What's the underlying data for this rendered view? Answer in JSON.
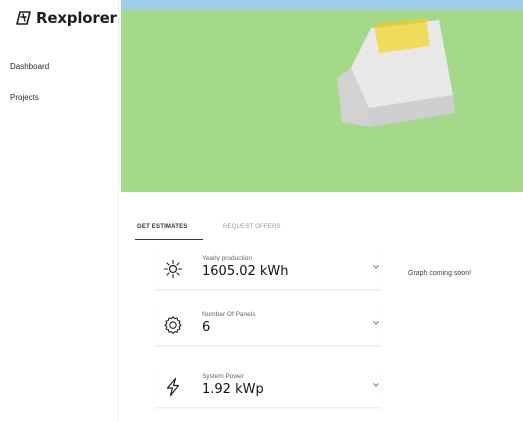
{
  "brand": {
    "name": "Rexplorer"
  },
  "sidebar": {
    "items": [
      {
        "label": "Dashboard"
      },
      {
        "label": "Projects"
      }
    ]
  },
  "tabs": [
    {
      "label": "GET ESTIMATES",
      "active": true
    },
    {
      "label": "REQUEST OFFERS",
      "active": false
    }
  ],
  "estimates": [
    {
      "icon": "sun-icon",
      "label": "Yearly production",
      "value": "1605.02 kWh"
    },
    {
      "icon": "gear-icon",
      "label": "Number Of Panels",
      "value": "6"
    },
    {
      "icon": "bolt-icon",
      "label": "System Power",
      "value": "1.92 kWp"
    }
  ],
  "graph": {
    "placeholder": "Graph coming soon!"
  },
  "colors": {
    "ground": "#a5d98a",
    "sky": "#9fcfe8",
    "roof_panel": "#f0dc5a",
    "building": "#e6e6e6"
  }
}
